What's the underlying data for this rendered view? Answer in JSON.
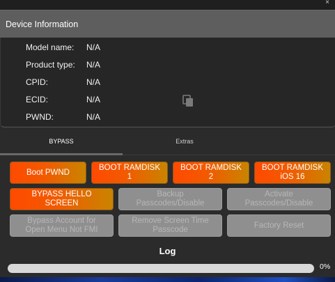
{
  "window": {
    "close_glyph": "×"
  },
  "device_card": {
    "title": "Device Information",
    "rows": [
      {
        "label": "Model name:",
        "value": "N/A"
      },
      {
        "label": "Product type:",
        "value": "N/A"
      },
      {
        "label": "CPID:",
        "value": "N/A"
      },
      {
        "label": "ECID:",
        "value": "N/A"
      },
      {
        "label": "PWND:",
        "value": "N/A"
      }
    ],
    "copy_icon": "copy-icon"
  },
  "tabs": [
    {
      "label": "BYPASS",
      "active": true
    },
    {
      "label": "Extras",
      "active": false
    }
  ],
  "buttons": [
    {
      "label": "Boot PWND",
      "enabled": true
    },
    {
      "label": "BOOT RAMDISK\n1",
      "enabled": true
    },
    {
      "label": "BOOT RAMDISK\n2",
      "enabled": true
    },
    {
      "label": "BOOT RAMDISK\niOS 16",
      "enabled": true
    },
    {
      "label": "BYPASS HELLO\nSCREEN",
      "enabled": true
    },
    {
      "label": "Backup\nPasscodes/Disable",
      "enabled": false
    },
    {
      "label": "Activate\nPasscodes/Disable",
      "enabled": false
    },
    {
      "label": "Bypass Account for\nOpen Menu Not FMI",
      "enabled": false
    },
    {
      "label": "Remove Screen Time\nPasscode",
      "enabled": false
    },
    {
      "label": "Factory Reset",
      "enabled": false
    }
  ],
  "log": {
    "label": "Log",
    "progress_percent": 0,
    "progress_text": "0%"
  },
  "colors": {
    "accent_orange": "#ff4a00",
    "accent_gold": "#c98400",
    "disabled_gray": "#8f8f8f",
    "background": "#2b2b2b"
  }
}
